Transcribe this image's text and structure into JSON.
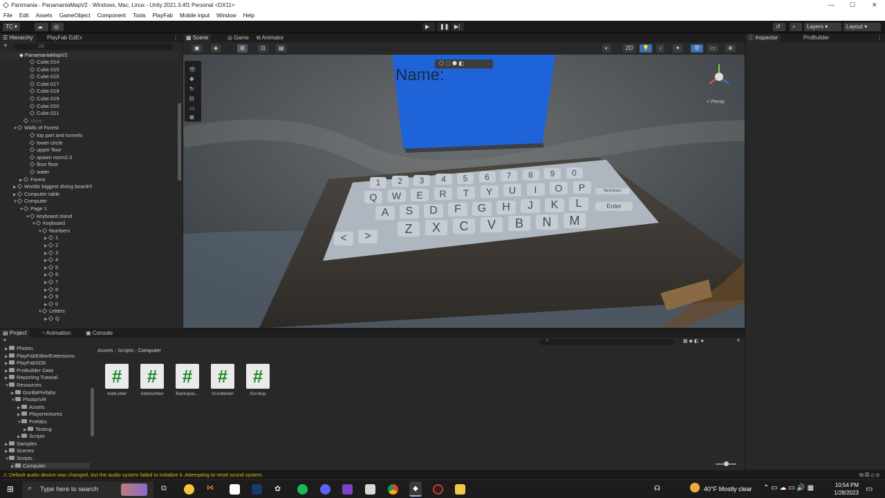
{
  "window": {
    "title": "Panimania - PanamaniaMapV2 - Windows, Mac, Linux - Unity 2021.3.4f1 Personal <DX11>",
    "minimize": "—",
    "maximize": "☐",
    "close": "✕"
  },
  "menu": [
    "File",
    "Edit",
    "Assets",
    "GameObject",
    "Component",
    "Tools",
    "PlayFab",
    "Mobile input",
    "Window",
    "Help"
  ],
  "toolbar": {
    "account": "TC ▾",
    "layers": "Layers",
    "layout": "Layout"
  },
  "hierarchy": {
    "tabs": [
      "Hierarchy",
      "PlayFab EdEx"
    ],
    "search_placeholder": "All",
    "scene_name": "PanamaniaMapV2",
    "rows": [
      {
        "label": "Cube.014",
        "indent": 5
      },
      {
        "label": "Cube.015",
        "indent": 5
      },
      {
        "label": "Cube.016",
        "indent": 5
      },
      {
        "label": "Cube.017",
        "indent": 5
      },
      {
        "label": "Cube.018",
        "indent": 5
      },
      {
        "label": "Cube.019",
        "indent": 5
      },
      {
        "label": "Cube.020",
        "indent": 5
      },
      {
        "label": "Cube.021",
        "indent": 5
      },
      {
        "label": "store",
        "indent": 4,
        "dim": true
      },
      {
        "label": "Walls of Forest",
        "indent": 3,
        "expanded": true
      },
      {
        "label": "top part and tunnels",
        "indent": 5
      },
      {
        "label": "lower circle",
        "indent": 5
      },
      {
        "label": "upper floor",
        "indent": 5
      },
      {
        "label": "spawn room2.0",
        "indent": 5
      },
      {
        "label": "floor floor",
        "indent": 5
      },
      {
        "label": "water",
        "indent": 5
      },
      {
        "label": "Forest",
        "indent": 4,
        "collapsed": true
      },
      {
        "label": "Worlds biggest diving board!!!",
        "indent": 3,
        "collapsed": true
      },
      {
        "label": "Computer table",
        "indent": 3,
        "collapsed": true
      },
      {
        "label": "Computer",
        "indent": 3,
        "expanded": true
      },
      {
        "label": "Page 1",
        "indent": 4,
        "expanded": true
      },
      {
        "label": "keyboard stand",
        "indent": 5,
        "expanded": true
      },
      {
        "label": "Keyboard",
        "indent": 6,
        "expanded": true
      },
      {
        "label": "Numbers",
        "indent": 7,
        "expanded": true
      },
      {
        "label": "1",
        "indent": 8,
        "collapsed": true
      },
      {
        "label": "2",
        "indent": 8,
        "collapsed": true
      },
      {
        "label": "3",
        "indent": 8,
        "collapsed": true
      },
      {
        "label": "4",
        "indent": 8,
        "collapsed": true
      },
      {
        "label": "5",
        "indent": 8,
        "collapsed": true
      },
      {
        "label": "6",
        "indent": 8,
        "collapsed": true
      },
      {
        "label": "7",
        "indent": 8,
        "collapsed": true
      },
      {
        "label": "8",
        "indent": 8,
        "collapsed": true
      },
      {
        "label": "9",
        "indent": 8,
        "collapsed": true
      },
      {
        "label": "0",
        "indent": 8,
        "collapsed": true
      },
      {
        "label": "Letters",
        "indent": 7,
        "expanded": true
      },
      {
        "label": "Q",
        "indent": 8,
        "collapsed": true
      }
    ]
  },
  "scene": {
    "tabs": [
      "Scene",
      "Game",
      "Animator"
    ],
    "mode_2d": "2D",
    "persp": "< Persp",
    "screen_text": "Name:",
    "keys_numbers": [
      "1",
      "2",
      "3",
      "4",
      "5",
      "6",
      "7",
      "8",
      "9",
      "0"
    ],
    "keys_row1": [
      "Q",
      "W",
      "E",
      "R",
      "T",
      "Y",
      "U",
      "I",
      "O",
      "P"
    ],
    "keys_row2": [
      "A",
      "S",
      "D",
      "F",
      "G",
      "H",
      "J",
      "K",
      "L"
    ],
    "keys_row3": [
      "Z",
      "X",
      "C",
      "V",
      "B",
      "N",
      "M"
    ],
    "key_back": "<",
    "key_fwd": ">",
    "key_enter": "Enter",
    "key_backspace": "BackSpace"
  },
  "inspector": {
    "tabs": [
      "Inspector",
      "ProBuilder"
    ]
  },
  "project": {
    "tabs": [
      "Project",
      "Animation",
      "Console"
    ],
    "tree": [
      {
        "label": "Photon",
        "indent": 1
      },
      {
        "label": "PlayFabEditorExtensions",
        "indent": 1
      },
      {
        "label": "PlayFabSDK",
        "indent": 1
      },
      {
        "label": "ProBuilder Data",
        "indent": 1
      },
      {
        "label": "Reporting Tutorial",
        "indent": 1
      },
      {
        "label": "Resources",
        "indent": 1,
        "expanded": true
      },
      {
        "label": "GorillaPrefabs",
        "indent": 2
      },
      {
        "label": "PhotonVR",
        "indent": 2,
        "expanded": true
      },
      {
        "label": "Assets",
        "indent": 3
      },
      {
        "label": "Playertextures",
        "indent": 3
      },
      {
        "label": "Prefabs",
        "indent": 3,
        "expanded": true
      },
      {
        "label": "Testing",
        "indent": 4
      },
      {
        "label": "Scripts",
        "indent": 3
      },
      {
        "label": "Samples",
        "indent": 1
      },
      {
        "label": "Scenes",
        "indent": 1
      },
      {
        "label": "Scripts",
        "indent": 1,
        "expanded": true
      },
      {
        "label": "Computer",
        "indent": 2,
        "selected": true
      }
    ],
    "breadcrumb": [
      "Assets",
      "Scripts",
      "Computer"
    ],
    "assets": [
      "AddLetter",
      "Addnumber",
      "Backspac...",
      "Scrolldown",
      "Scrollup"
    ],
    "asset_glyph": "#",
    "count_badge": "4"
  },
  "status": {
    "message": "Default audio device was changed, but the audio system failed to initialize it. Attempting to reset sound system."
  },
  "taskbar": {
    "search_placeholder": "Type here to search",
    "weather": "40°F  Mostly clear",
    "time": "10:54 PM",
    "date": "1/28/2023"
  },
  "colors": {
    "unity_dark": "#282828",
    "scene_sky": "#4d5153",
    "screen_blue": "#1f63d8",
    "key": "#c6ccd3",
    "warning": "#e6b400",
    "script_green": "#1d8a2a"
  }
}
